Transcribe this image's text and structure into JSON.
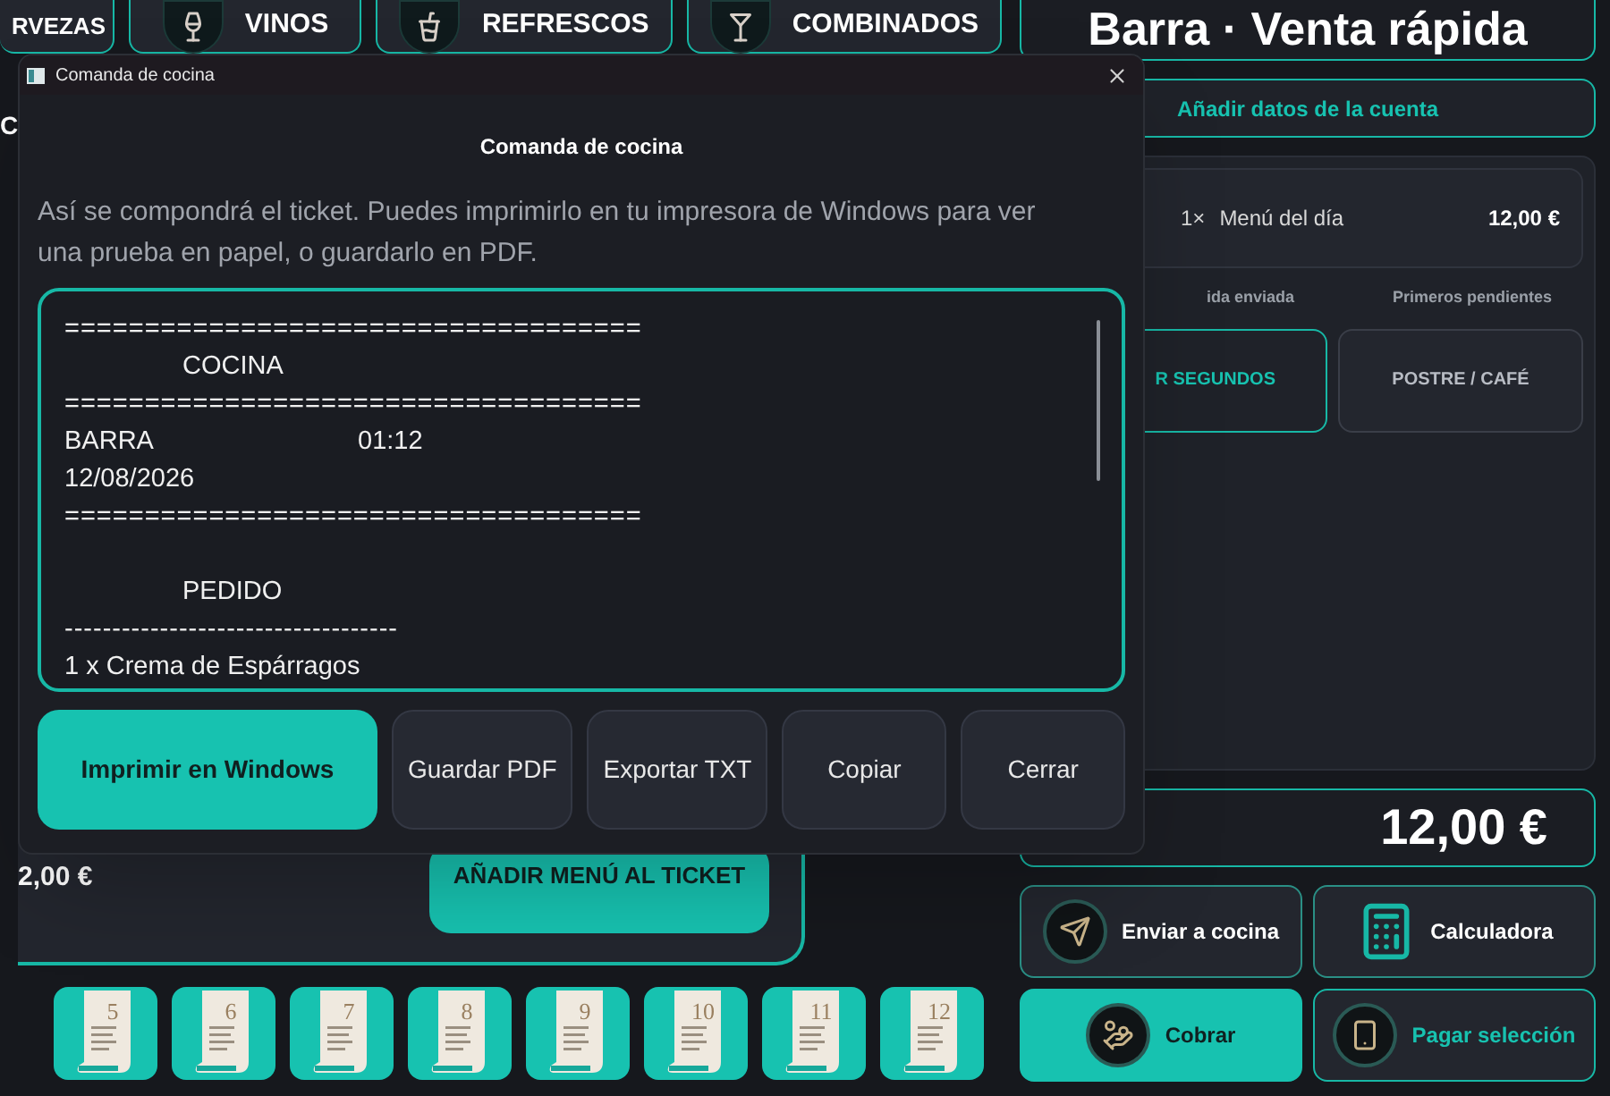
{
  "categories": [
    {
      "label": "RVEZAS"
    },
    {
      "label": "VINOS"
    },
    {
      "label": "REFRESCOS"
    },
    {
      "label": "COMBINADOS"
    }
  ],
  "left_fragments": [
    "C"
  ],
  "menu_card": {
    "price": "2,00 €",
    "add_button": "AÑADIR MENÚ AL TICKET"
  },
  "menu_tiles": [
    "5",
    "6",
    "7",
    "8",
    "9",
    "10",
    "11",
    "12"
  ],
  "panel": {
    "title": "Barra · Venta rápida",
    "account_button": "Añadir datos de la cuenta",
    "order_items": [
      {
        "qty": "1×",
        "name": "Menú del día",
        "price": "12,00 €"
      }
    ],
    "course_labels": [
      "ida enviada",
      "Primeros pendientes"
    ],
    "course_buttons": [
      {
        "label": "R SEGUNDOS",
        "selected": true
      },
      {
        "label": "POSTRE / CAFÉ",
        "selected": false
      }
    ],
    "total": "12,00 €",
    "actions": [
      {
        "label": "Enviar a cocina",
        "selected": false
      },
      {
        "label": "Calculadora",
        "selected": false
      },
      {
        "label": "Cobrar",
        "selected": true
      },
      {
        "label": "Pagar selección",
        "selected": false
      }
    ]
  },
  "dialog": {
    "window_title": "Comanda de cocina",
    "heading": "Comanda de cocina",
    "description": "Así se compondrá el ticket. Puedes imprimirlo en tu impresora de Windows para ver una prueba en papel, o guardarlo en PDF.",
    "ticket_lines": [
      {
        "kind": "rule",
        "text": "===================================="
      },
      {
        "kind": "heading",
        "text": "COCINA"
      },
      {
        "kind": "rule",
        "text": "===================================="
      },
      {
        "kind": "pair",
        "left": "BARRA",
        "right": "01:12"
      },
      {
        "kind": "text",
        "text": "12/08/2026"
      },
      {
        "kind": "rule",
        "text": "===================================="
      },
      {
        "kind": "spacer"
      },
      {
        "kind": "heading",
        "text": "PEDIDO"
      },
      {
        "kind": "rule",
        "text": "-----------------------------------"
      },
      {
        "kind": "text",
        "text": "1 x Crema de Espárragos"
      }
    ],
    "buttons": [
      {
        "label": "Imprimir en Windows",
        "primary": true
      },
      {
        "label": "Guardar PDF",
        "primary": false
      },
      {
        "label": "Exportar TXT",
        "primary": false
      },
      {
        "label": "Copiar",
        "primary": false
      },
      {
        "label": "Cerrar",
        "primary": false
      }
    ]
  }
}
